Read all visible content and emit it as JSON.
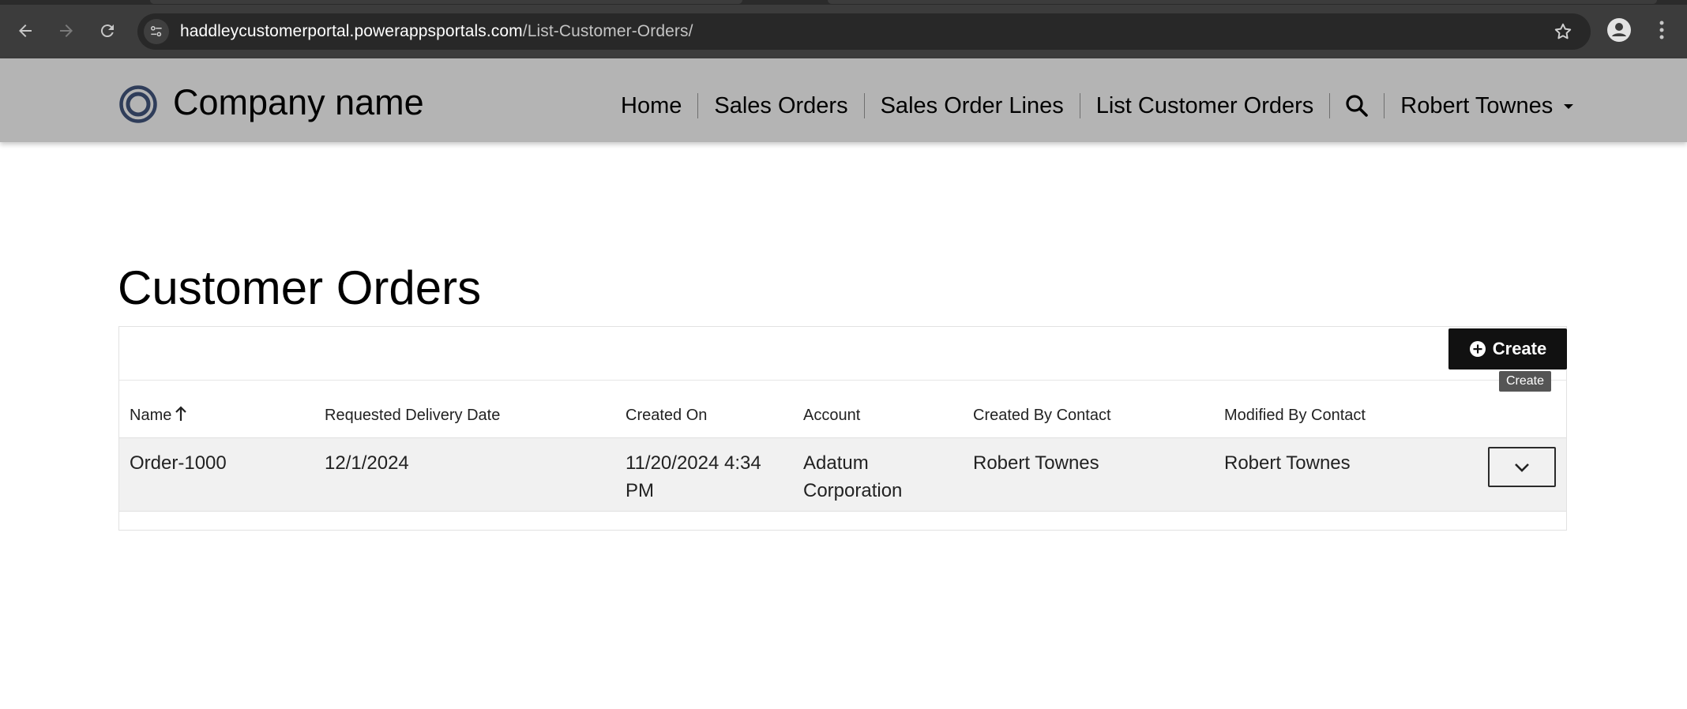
{
  "browser": {
    "url_host": "haddleycustomerportal.powerappsportals.com",
    "url_path": "/List-Customer-Orders/",
    "icons": [
      "back-arrow-icon",
      "forward-arrow-icon",
      "reload-icon",
      "site-settings-icon",
      "star-icon",
      "profile-icon",
      "more-vert-icon"
    ]
  },
  "header": {
    "brand": "Company name",
    "nav": {
      "home": "Home",
      "sales_orders": "Sales Orders",
      "sales_order_lines": "Sales Order Lines",
      "list_customer_orders": "List Customer Orders",
      "user": "Robert Townes"
    },
    "colors": {
      "background": "#b4b4b4",
      "logo": "#2f3d5a"
    }
  },
  "page": {
    "title": "Customer Orders",
    "create_label": "Create",
    "create_tooltip": "Create",
    "table": {
      "columns": [
        "Name",
        "Requested Delivery Date",
        "Created On",
        "Account",
        "Created By Contact",
        "Modified By Contact"
      ],
      "rows": [
        {
          "name": "Order-1000",
          "requested_delivery_date": "12/1/2024",
          "created_on_line1": "11/20/2024 4:34",
          "created_on_line2": "PM",
          "account_line1": "Adatum",
          "account_line2": "Corporation",
          "created_by": "Robert Townes",
          "modified_by": "Robert Townes"
        }
      ]
    }
  }
}
